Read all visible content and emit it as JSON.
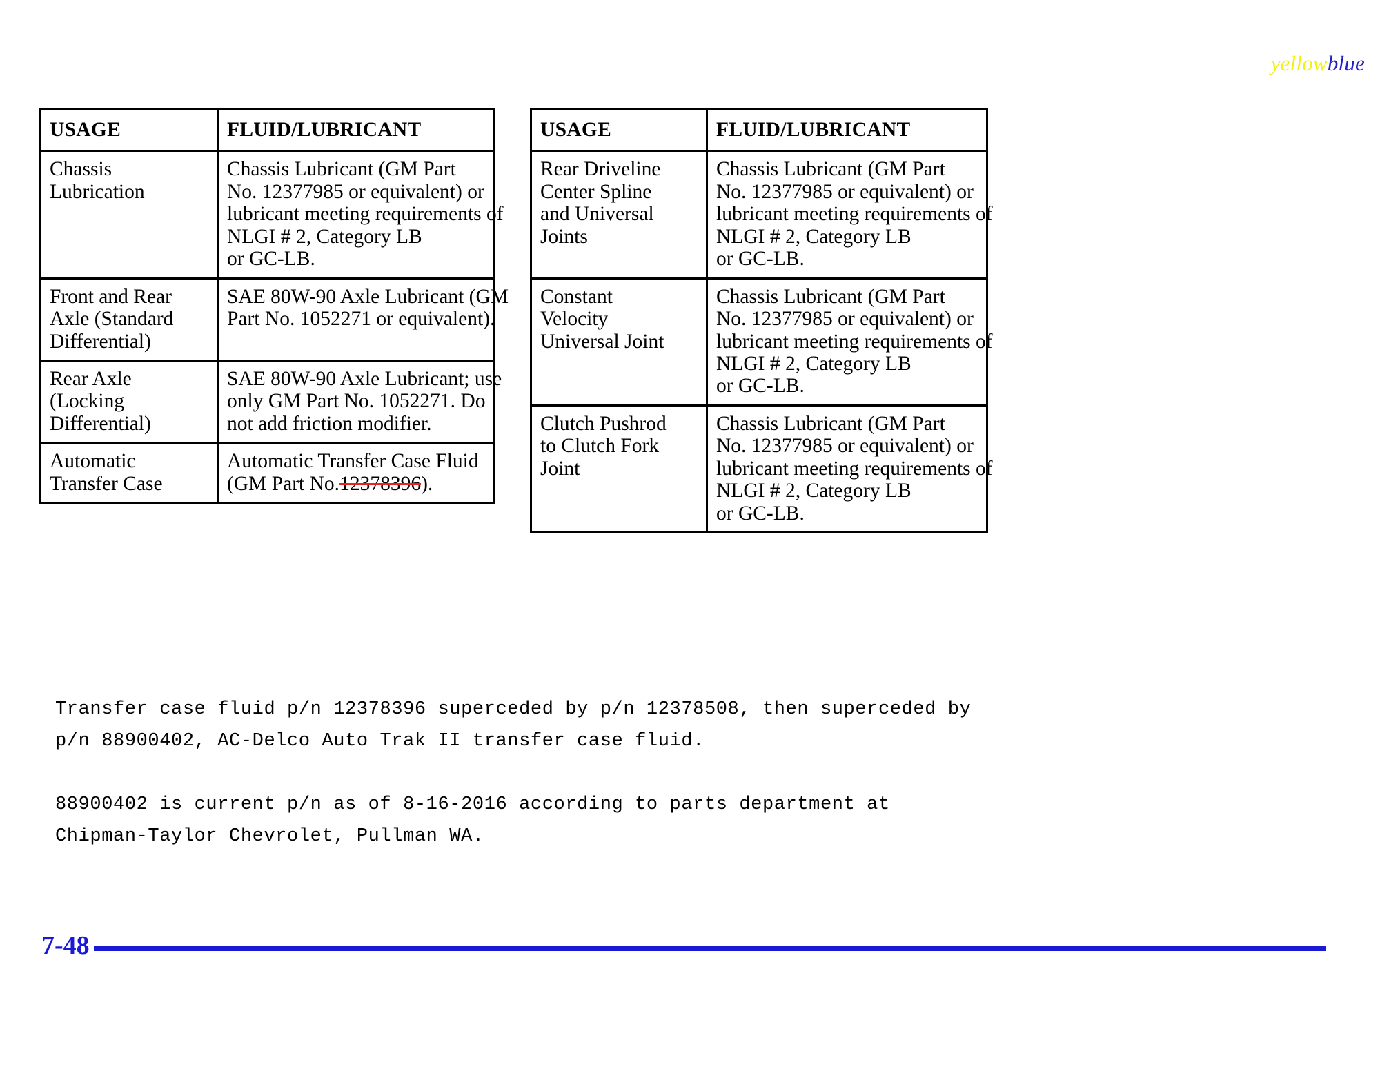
{
  "logo": {
    "part1": "yellow",
    "part2": "blue",
    "color1": "#f2f20a",
    "color2": "#2020c8"
  },
  "tables": {
    "headers": {
      "usage": "USAGE",
      "fluid": "FLUID/LUBRICANT"
    },
    "left": [
      {
        "usage": [
          "Chassis",
          "Lubrication"
        ],
        "fluid": [
          "Chassis Lubricant (GM Part",
          "No. 12377985 or equivalent) or",
          "lubricant meeting requirements of",
          "NLGI # 2, Category LB",
          "or GC-LB."
        ]
      },
      {
        "usage": [
          "Front and Rear",
          "Axle (Standard",
          "Differential)"
        ],
        "fluid": [
          "SAE 80W-90 Axle Lubricant (GM",
          "Part No. 1052271 or equivalent)."
        ]
      },
      {
        "usage": [
          "Rear Axle",
          "(Locking",
          "Differential)"
        ],
        "fluid": [
          "SAE 80W-90 Axle Lubricant; use",
          "only GM Part No. 1052271. Do",
          "not add friction modifier."
        ]
      },
      {
        "usage": [
          "Automatic",
          "Transfer Case"
        ],
        "fluid": [
          "Automatic Transfer Case Fluid"
        ],
        "fluid_last_prefix": "(GM Part No.",
        "fluid_last_struck": "12378396",
        "fluid_last_suffix": ")."
      }
    ],
    "right": [
      {
        "usage": [
          "Rear Driveline",
          "Center Spline",
          "and Universal",
          "Joints"
        ],
        "fluid": [
          "Chassis Lubricant (GM Part",
          "No. 12377985 or equivalent) or",
          "lubricant meeting requirements of",
          "NLGI # 2, Category LB",
          "or GC-LB."
        ]
      },
      {
        "usage": [
          "Constant",
          "Velocity",
          "Universal Joint"
        ],
        "fluid": [
          "Chassis Lubricant (GM Part",
          "No. 12377985 or equivalent) or",
          "lubricant meeting requirements of",
          "NLGI # 2, Category LB",
          "or GC-LB."
        ]
      },
      {
        "usage": [
          "Clutch Pushrod",
          "to Clutch Fork",
          "Joint"
        ],
        "fluid": [
          "Chassis Lubricant (GM Part",
          "No. 12377985 or equivalent) or",
          "lubricant meeting requirements of",
          "NLGI # 2, Category LB",
          "or GC-LB."
        ]
      }
    ]
  },
  "notes": [
    [
      "Transfer case fluid p/n 12378396 superceded by p/n 12378508, then superceded by",
      "p/n 88900402, AC-Delco Auto Trak II transfer case fluid."
    ],
    [
      "88900402 is current p/n as of 8-16-2016 according to parts department at",
      "Chipman-Taylor Chevrolet, Pullman WA."
    ]
  ],
  "footer": {
    "page": "7-48",
    "rule_color": "#1a1ad6"
  }
}
